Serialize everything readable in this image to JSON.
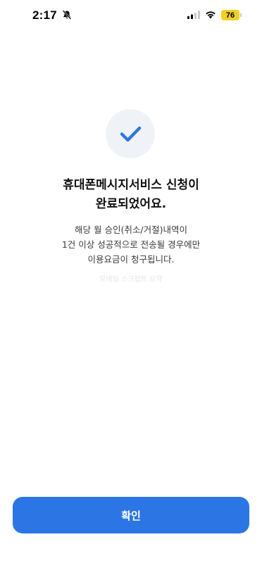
{
  "status_bar": {
    "time": "2:17",
    "battery_level": "76",
    "icons": [
      "silent-bell-icon",
      "signal-icon",
      "wifi-icon",
      "battery-icon"
    ]
  },
  "result": {
    "icon": "check-icon",
    "title_line1": "휴대폰메시지서비스 신청이",
    "title_line2": "완료되었어요.",
    "desc_line1": "해당 월 승인(취소/거절)내역이",
    "desc_line2": "1건 이상 성공적으로 전송될 경우에만",
    "desc_line3": "이용요금이 청구됩니다.",
    "watermark": "모바일 스크립트 요약"
  },
  "footer": {
    "confirm_label": "확인"
  },
  "colors": {
    "accent": "#2B75E5",
    "circle_bg": "#EFF2F7",
    "battery": "#F2D024"
  }
}
